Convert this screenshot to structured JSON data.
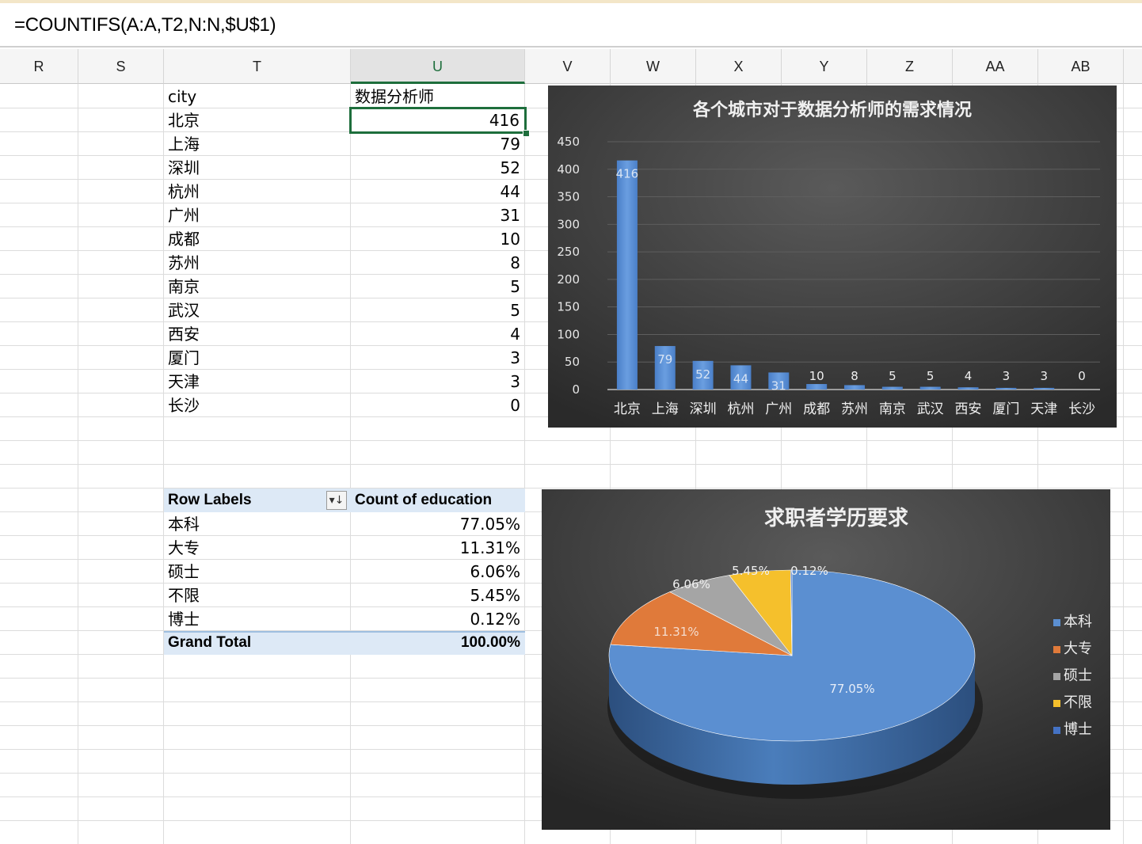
{
  "formula_bar": {
    "formula": "=COUNTIFS(A:A,T2,N:N,$U$1)"
  },
  "columns": [
    "R",
    "S",
    "T",
    "U",
    "V",
    "W",
    "X",
    "Y",
    "Z",
    "AA",
    "AB"
  ],
  "city_table": {
    "header_city": "city",
    "header_value": "数据分析师",
    "rows": [
      {
        "city": "北京",
        "value": "416"
      },
      {
        "city": "上海",
        "value": "79"
      },
      {
        "city": "深圳",
        "value": "52"
      },
      {
        "city": "杭州",
        "value": "44"
      },
      {
        "city": "广州",
        "value": "31"
      },
      {
        "city": "成都",
        "value": "10"
      },
      {
        "city": "苏州",
        "value": "8"
      },
      {
        "city": "南京",
        "value": "5"
      },
      {
        "city": "武汉",
        "value": "5"
      },
      {
        "city": "西安",
        "value": "4"
      },
      {
        "city": "厦门",
        "value": "3"
      },
      {
        "city": "天津",
        "value": "3"
      },
      {
        "city": "长沙",
        "value": "0"
      }
    ]
  },
  "pivot": {
    "row_labels": "Row Labels",
    "count_label": "Count of education",
    "rows": [
      {
        "label": "本科",
        "value": "77.05%"
      },
      {
        "label": "大专",
        "value": "11.31%"
      },
      {
        "label": "硕士",
        "value": "6.06%"
      },
      {
        "label": "不限",
        "value": "5.45%"
      },
      {
        "label": "博士",
        "value": "0.12%"
      }
    ],
    "total_label": "Grand Total",
    "total_value": "100.00%"
  },
  "chart_data": [
    {
      "type": "bar",
      "title": "各个城市对于数据分析师的需求情况",
      "categories": [
        "北京",
        "上海",
        "深圳",
        "杭州",
        "广州",
        "成都",
        "苏州",
        "南京",
        "武汉",
        "西安",
        "厦门",
        "天津",
        "长沙"
      ],
      "values": [
        416,
        79,
        52,
        44,
        31,
        10,
        8,
        5,
        5,
        4,
        3,
        3,
        0
      ],
      "ylim": [
        0,
        450
      ],
      "yticks": [
        0,
        50,
        100,
        150,
        200,
        250,
        300,
        350,
        400,
        450
      ],
      "grid": true,
      "color": "#5b8fd1"
    },
    {
      "type": "pie",
      "title": "求职者学历要求",
      "labels": [
        "本科",
        "大专",
        "硕士",
        "不限",
        "博士"
      ],
      "values": [
        77.05,
        11.31,
        6.06,
        5.45,
        0.12
      ],
      "value_labels": [
        "77.05%",
        "11.31%",
        "6.06%",
        "5.45%",
        "0.12%"
      ],
      "colors": [
        "#5b8fd1",
        "#e07a3a",
        "#a5a5a5",
        "#f5c02c",
        "#4472c4"
      ],
      "legend_position": "right"
    }
  ]
}
